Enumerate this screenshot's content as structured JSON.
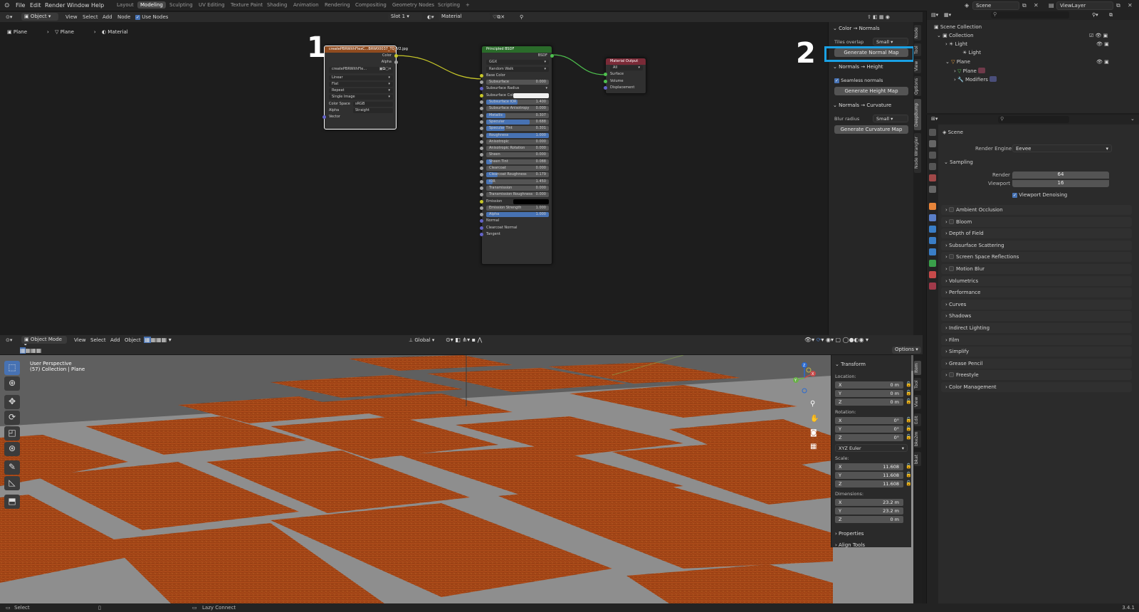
{
  "topbar": {
    "menus": [
      "File",
      "Edit",
      "Render",
      "Window",
      "Help"
    ],
    "workspaces": [
      "Layout",
      "Modeling",
      "Sculpting",
      "UV Editing",
      "Texture Paint",
      "Shading",
      "Animation",
      "Rendering",
      "Compositing",
      "Geometry Nodes",
      "Scripting",
      "+"
    ],
    "active_workspace": "Modeling",
    "scene": "Scene",
    "view_layer": "ViewLayer"
  },
  "node_header": {
    "editor": "Object",
    "view": "View",
    "select": "Select",
    "add": "Add",
    "node": "Node",
    "use_nodes": "Use Nodes",
    "slot": "Slot 1",
    "material": "Material"
  },
  "breadcrumb": [
    "Plane",
    "Plane",
    "Material"
  ],
  "annotations": {
    "one": "1",
    "two": "2"
  },
  "image_node": {
    "title": "createPBRWithFlexC...BRW00037_TQ_V2.jpg",
    "out_color": "Color",
    "out_alpha": "Alpha",
    "image_field": "createPBRWithFle...",
    "interp": "Linear",
    "proj": "Flat",
    "ext": "Repeat",
    "source": "Single Image",
    "cs_label": "Color Space",
    "cs_val": "sRGB",
    "alpha_label": "Alpha",
    "alpha_val": "Straight",
    "in_vector": "Vector"
  },
  "bsdf_node": {
    "title": "Principled BSDF",
    "out": "BSDF",
    "dist": "GGX",
    "sss_method": "Random Walk",
    "rows": [
      {
        "label": "Base Color",
        "type": "socket",
        "sock": "#c7c729"
      },
      {
        "label": "Subsurface",
        "value": "0.000",
        "fill": 0.0,
        "sock": "#a1a1a1"
      },
      {
        "label": "Subsurface Radius",
        "type": "dropdown",
        "sock": "#6363c7"
      },
      {
        "label": "Subsurface Color",
        "type": "color",
        "sock": "#c7c729"
      },
      {
        "label": "Subsurface IOR",
        "value": "1.400",
        "fill": 0.5,
        "sock": "#a1a1a1"
      },
      {
        "label": "Subsurface Anisotropy",
        "value": "0.000",
        "fill": 0.0,
        "sock": "#a1a1a1"
      },
      {
        "label": "Metallic",
        "value": "0.307",
        "fill": 0.31,
        "sock": "#a1a1a1"
      },
      {
        "label": "Specular",
        "value": "0.688",
        "fill": 0.69,
        "sock": "#a1a1a1"
      },
      {
        "label": "Specular Tint",
        "value": "0.301",
        "fill": 0.3,
        "sock": "#a1a1a1"
      },
      {
        "label": "Roughness",
        "value": "1.000",
        "fill": 1.0,
        "sock": "#a1a1a1"
      },
      {
        "label": "Anisotropic",
        "value": "0.000",
        "fill": 0.0,
        "sock": "#a1a1a1"
      },
      {
        "label": "Anisotropic Rotation",
        "value": "0.000",
        "fill": 0.0,
        "sock": "#a1a1a1"
      },
      {
        "label": "Sheen",
        "value": "0.000",
        "fill": 0.0,
        "sock": "#a1a1a1"
      },
      {
        "label": "Sheen Tint",
        "value": "0.088",
        "fill": 0.09,
        "sock": "#a1a1a1"
      },
      {
        "label": "Clearcoat",
        "value": "0.000",
        "fill": 0.0,
        "sock": "#a1a1a1"
      },
      {
        "label": "Clearcoat Roughness",
        "value": "0.179",
        "fill": 0.18,
        "sock": "#a1a1a1"
      },
      {
        "label": "IOR",
        "value": "1.450",
        "fill": 0.1,
        "sock": "#a1a1a1"
      },
      {
        "label": "Transmission",
        "value": "0.000",
        "fill": 0.0,
        "sock": "#a1a1a1"
      },
      {
        "label": "Transmission Roughness",
        "value": "0.000",
        "fill": 0.0,
        "sock": "#a1a1a1"
      },
      {
        "label": "Emission",
        "type": "color-dark",
        "sock": "#c7c729"
      },
      {
        "label": "Emission Strength",
        "value": "1.000",
        "fill": 0.0,
        "sock": "#a1a1a1"
      },
      {
        "label": "Alpha",
        "value": "1.000",
        "fill": 1.0,
        "sock": "#a1a1a1"
      },
      {
        "label": "Normal",
        "type": "socket",
        "sock": "#6363c7"
      },
      {
        "label": "Clearcoat Normal",
        "type": "socket",
        "sock": "#6363c7"
      },
      {
        "label": "Tangent",
        "type": "socket",
        "sock": "#6363c7"
      }
    ]
  },
  "output_node": {
    "title": "Material Output",
    "target": "All",
    "inputs": [
      "Surface",
      "Volume",
      "Displacement"
    ]
  },
  "npanel": {
    "sec1": "Color → Normals",
    "tiles_label": "Tiles overlap",
    "tiles_val": "Small",
    "btn1": "Generate Normal Map",
    "sec2": "Normals → Height",
    "seamless": "Seamless normals",
    "btn2": "Generate Height Map",
    "sec3": "Normals → Curvature",
    "blur_label": "Blur radius",
    "blur_val": "Small",
    "btn3": "Generate Curvature Map"
  },
  "npanel_tabs": [
    "Node",
    "Tool",
    "View",
    "Options",
    "DeepBump",
    "Node Wrangler"
  ],
  "outliner": {
    "items": [
      "Scene Collection",
      "Collection",
      "Light",
      "Light",
      "Plane",
      "Plane",
      "Modifiers"
    ]
  },
  "properties": {
    "scene": "Scene",
    "render_engine_label": "Render Engine",
    "render_engine": "Eevee",
    "sampling": "Sampling",
    "render_label": "Render",
    "render_val": "64",
    "viewport_label": "Viewport",
    "viewport_val": "16",
    "denoise": "Viewport Denoising",
    "sections": [
      "Ambient Occlusion",
      "Bloom",
      "Depth of Field",
      "Subsurface Scattering",
      "Screen Space Reflections",
      "Motion Blur",
      "Volumetrics",
      "Performance",
      "Curves",
      "Shadows",
      "Indirect Lighting",
      "Film",
      "Simplify",
      "Grease Pencil",
      "Freestyle",
      "Color Management"
    ],
    "checkbox_sections": [
      "Ambient Occlusion",
      "Bloom",
      "Screen Space Reflections",
      "Motion Blur",
      "Freestyle"
    ]
  },
  "viewport_header": {
    "mode": "Object Mode",
    "view": "View",
    "select": "Select",
    "add": "Add",
    "object": "Object",
    "orientation": "Global",
    "options": "Options"
  },
  "viewport": {
    "line1": "User Perspective",
    "line2": "(57) Collection | Plane"
  },
  "transform": {
    "title": "Transform",
    "location": "Location:",
    "loc": [
      "0 m",
      "0 m",
      "0 m"
    ],
    "rotation": "Rotation:",
    "rot": [
      "0°",
      "0°",
      "0°"
    ],
    "euler": "XYZ Euler",
    "scale": "Scale:",
    "scl": [
      "11.608",
      "11.608",
      "11.608"
    ],
    "dimensions": "Dimensions:",
    "dim": [
      "23.2 m",
      "23.2 m",
      "0 m"
    ],
    "axes": [
      "X",
      "Y",
      "Z"
    ],
    "properties": "Properties",
    "align": "Align Tools"
  },
  "vp_tabs": [
    "Item",
    "Tool",
    "View",
    "Edit",
    "bke2m",
    "bkat"
  ],
  "statusbar": {
    "left": "Select",
    "mid": "Lazy Connect",
    "version": "3.4.1"
  }
}
